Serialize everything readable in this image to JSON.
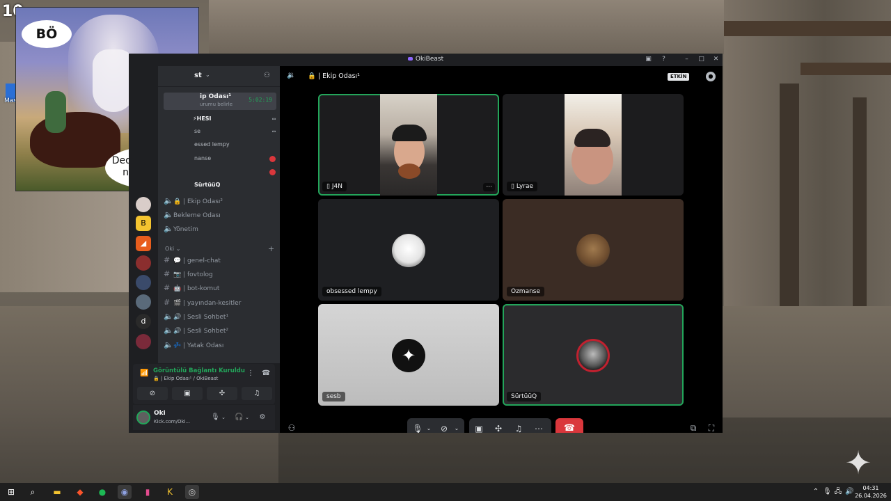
{
  "overlay": {
    "frame_counter": "10",
    "desktop_icon_label": "Mas"
  },
  "meme": {
    "bubble_top": "BÖ",
    "bubble_bottom_line1": "Dede korkuttun",
    "bubble_bottom_line2": "napıyon aq"
  },
  "window": {
    "title": "OkiBeast"
  },
  "sidebar": {
    "server_name": "st",
    "active_channel": "ip Odası¹",
    "active_timer": "5:02:19",
    "active_sub": "urumu belirle",
    "voice_users": [
      {
        "name": "HESI"
      },
      {
        "name": "se"
      },
      {
        "name": "essed lempy"
      },
      {
        "name": "nanse"
      },
      {
        "name": ""
      },
      {
        "name": "SürtüüQ"
      }
    ],
    "channels_a": [
      {
        "icon": "speaker",
        "label": "🔒 | Ekip Odası²"
      },
      {
        "icon": "speaker",
        "label": "Bekleme Odası"
      },
      {
        "icon": "speaker",
        "label": "Yönetim"
      }
    ],
    "category_oki": "Oki",
    "channels_b": [
      {
        "icon": "#",
        "label": "💬 | genel-chat"
      },
      {
        "icon": "#",
        "label": "📷 | fovtolog"
      },
      {
        "icon": "#",
        "label": "🤖 | bot-komut"
      },
      {
        "icon": "#",
        "label": "🎬 | yayından-kesitler"
      },
      {
        "icon": "speaker",
        "label": "🔊 | Sesli Sohbet¹"
      },
      {
        "icon": "speaker",
        "label": "🔊 | Sesli Sohbet²"
      },
      {
        "icon": "speaker",
        "label": "💤 | Yatak Odası"
      }
    ]
  },
  "connection": {
    "title": "Görüntülü Bağlantı Kuruldu",
    "subtitle": "🔒 | Ekip Odası¹ / OkiBeast"
  },
  "user": {
    "name": "Oki",
    "status": "Kick.com/Oki..."
  },
  "stage": {
    "title": "🔒 | Ekip Odası¹",
    "etkin_label": "ETKİN",
    "tiles": [
      {
        "name": "J4N",
        "mobile": true,
        "speaking": true
      },
      {
        "name": "Lyrae",
        "mobile": true,
        "speaking": false
      },
      {
        "name": "obsessed lempy",
        "mobile": false,
        "speaking": false
      },
      {
        "name": "Ozmanse",
        "mobile": false,
        "speaking": false
      },
      {
        "name": "sesb",
        "mobile": false,
        "speaking": false
      },
      {
        "name": "SürtüüQ",
        "mobile": false,
        "speaking": true
      }
    ],
    "more_label": "···"
  },
  "taskbar": {
    "time": "04:31",
    "date": "26.04.2026"
  },
  "colors": {
    "accent_green": "#23a55a",
    "hangup_red": "#da373c",
    "bg_dark": "#1e1f22"
  }
}
